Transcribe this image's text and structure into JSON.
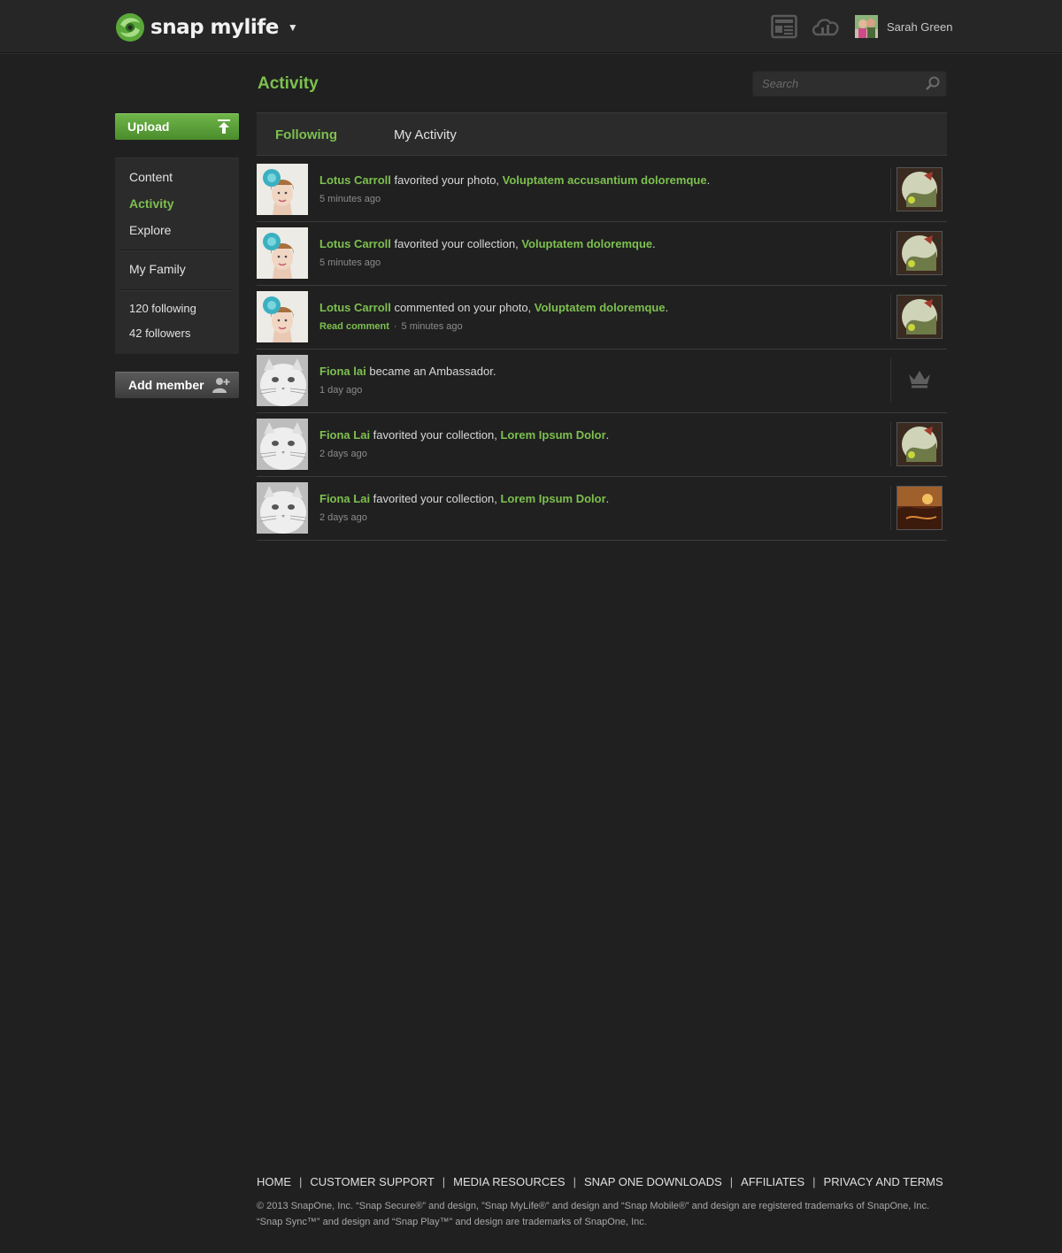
{
  "brand": {
    "name": "snap mylife",
    "caret": "▼",
    "green": "#7dc04f"
  },
  "header": {
    "icons": [
      "news-icon",
      "cloud-icon"
    ],
    "user": {
      "name": "Sarah Green"
    }
  },
  "sidebar": {
    "upload_label": "Upload",
    "nav": [
      {
        "label": "Content"
      },
      {
        "label": "Activity",
        "active": true
      },
      {
        "label": "Explore"
      }
    ],
    "family_label": "My Family",
    "following": "120 following",
    "followers": "42 followers",
    "add_member_label": "Add member"
  },
  "main": {
    "title": "Activity",
    "search_placeholder": "Search",
    "tabs": [
      {
        "label": "Following",
        "active": true
      },
      {
        "label": "My Activity"
      }
    ],
    "feed": [
      {
        "user": "Lotus Carroll",
        "action": " favorited your photo, ",
        "object": "Voluptatem accusantium doloremque",
        "end": ".",
        "read_comment": "",
        "time": "5 minutes ago"
      },
      {
        "user": "Lotus Carroll",
        "action": " favorited your collection, ",
        "object": "Voluptatem doloremque",
        "end": ".",
        "read_comment": "",
        "time": "5 minutes ago"
      },
      {
        "user": "Lotus Carroll",
        "action": " commented on your photo, ",
        "object": "Voluptatem doloremque",
        "end": ".",
        "read_comment": "Read comment",
        "time": "5 minutes ago"
      },
      {
        "user": "Fiona lai",
        "action": " became an Ambassador.",
        "object": "",
        "end": "",
        "read_comment": "",
        "time": "1 day ago"
      },
      {
        "user": "Fiona Lai",
        "action": " favorited your collection, ",
        "object": "Lorem Ipsum Dolor",
        "end": ".",
        "read_comment": "",
        "time": "2 days ago"
      },
      {
        "user": "Fiona Lai",
        "action": " favorited your collection, ",
        "object": "Lorem Ipsum Dolor",
        "end": ".",
        "read_comment": "",
        "time": "2 days ago"
      }
    ]
  },
  "footer": {
    "links": [
      "HOME",
      "CUSTOMER SUPPORT",
      "MEDIA RESOURCES",
      "SNAP ONE DOWNLOADS",
      "AFFILIATES",
      "PRIVACY AND TERMS"
    ],
    "separator": "|",
    "legal_1": "© 2013 SnapOne, Inc.  “Snap Secure®” and design, ”Snap MyLife®” and design and “Snap Mobile®” and design are registered trademarks of SnapOne, Inc.",
    "legal_2": "“Snap Sync™” and design and “Snap Play™” and design are trademarks of SnapOne, Inc."
  }
}
